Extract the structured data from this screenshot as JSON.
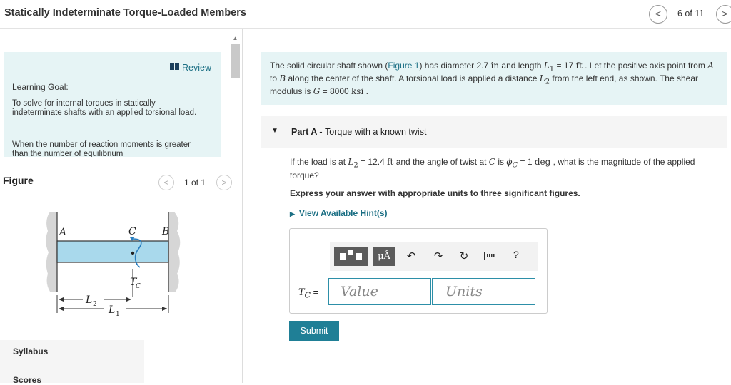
{
  "header": {
    "title": "Statically Indeterminate Torque-Loaded Members",
    "prev": "<",
    "next": ">",
    "counter": "6 of 11"
  },
  "learning_goal": {
    "review": "Review",
    "heading": "Learning Goal:",
    "text": "To solve for internal torques in statically indeterminate shafts with an applied torsional load.",
    "text2": "When the number of reaction moments is greater than the number of equilibrium"
  },
  "figure": {
    "label": "Figure",
    "counter": "1 of 1",
    "prev": "<",
    "next": ">",
    "labels": {
      "A": "A",
      "C": "C",
      "B": "B",
      "T": "T",
      "Tsub": "C",
      "L2": "L",
      "L2sub": "2",
      "L1": "L",
      "L1sub": "1"
    }
  },
  "sidebar": {
    "syllabus": "Syllabus",
    "scores": "Scores"
  },
  "problem": {
    "t1": "The solid circular shaft shown (",
    "link": "Figure 1",
    "t2": ") has diameter 2.7 ",
    "u1": "in",
    "t3": " and length ",
    "L": "L",
    "Lsub": "1",
    "t4": " = 17 ",
    "u2": "ft",
    "t5": " . Let the positive axis point from ",
    "A": "A",
    "t6": " to ",
    "B": "B",
    "t7": " along the center of the shaft. A torsional load is applied a distance ",
    "L2": "L",
    "L2sub": "2",
    "t8": " from the left end, as shown. The shear modulus is ",
    "G": "G",
    "t9": " = 8000 ",
    "u3": "ksi",
    "t10": " ."
  },
  "part_a": {
    "toggle": "▼",
    "label": "Part A - ",
    "title": "Torque with a known twist"
  },
  "question": {
    "t1": "If the load is at ",
    "L": "L",
    "Lsub": "2",
    "t2": " = 12.4 ",
    "u1": "ft",
    "t3": " and the angle of twist at ",
    "C": "C",
    "t4": " is ",
    "phi": "ϕ",
    "phisub": "C",
    "t5": " = 1 ",
    "u2": "deg",
    "t6": " , what is the magnitude of the applied torque?"
  },
  "express": "Express your answer with appropriate units to three significant figures.",
  "hints": {
    "toggle": "▶",
    "label": "View Available Hint(s)"
  },
  "answer": {
    "mu_label": "μÅ",
    "undo": "↶",
    "redo": "↷",
    "reset": "↻",
    "help": "?",
    "T": "T",
    "Tsub": "C",
    "eq": " =",
    "value_placeholder": "Value",
    "units_placeholder": "Units"
  },
  "submit_label": "Submit"
}
